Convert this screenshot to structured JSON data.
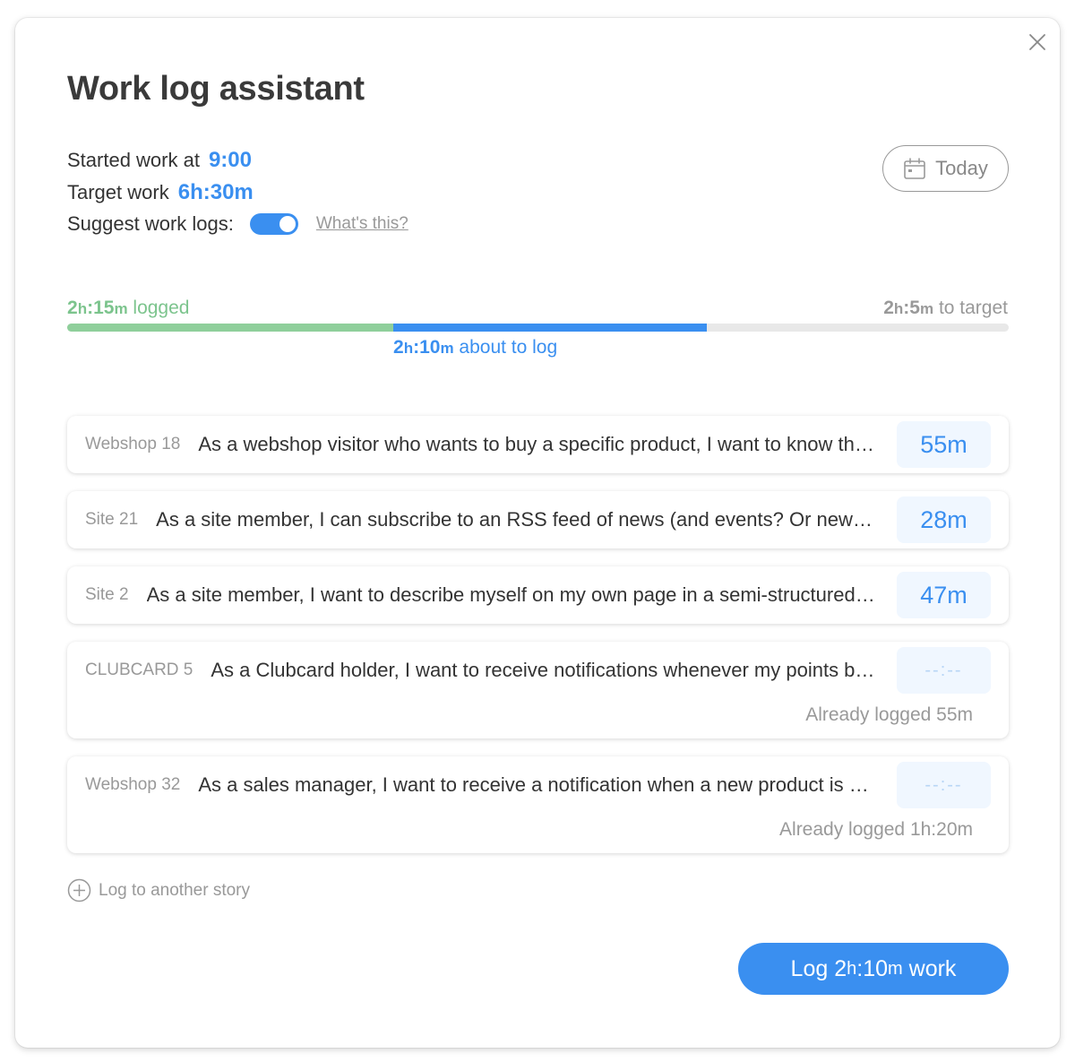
{
  "dialog": {
    "title": "Work log assistant",
    "close_icon": "close-icon"
  },
  "info": {
    "started_label": "Started work at",
    "started_value": "9:00",
    "target_label": "Target work",
    "target_value": "6h:30m",
    "suggest_label": "Suggest work logs:",
    "suggest_enabled": true,
    "whats_this": "What's this?"
  },
  "date_button": {
    "label": "Today",
    "icon": "calendar-icon"
  },
  "progress": {
    "logged_hours": "2",
    "logged_minutes": "15",
    "logged_suffix": "logged",
    "pending_hours": "2",
    "pending_minutes": "10",
    "pending_suffix": "about to log",
    "remaining_hours": "2",
    "remaining_minutes": "5",
    "remaining_suffix": "to target",
    "logged_fraction": 0.346,
    "pending_fraction": 0.333,
    "colors": {
      "logged": "#8fcf9b",
      "pending": "#3a8ff0",
      "track": "#e8e8e8"
    }
  },
  "stories": [
    {
      "key": "Webshop 18",
      "title": "As a webshop visitor who wants to buy a specific product, I want to know the product's availability before I order it.",
      "time": "55m",
      "already_logged": ""
    },
    {
      "key": "Site 21",
      "title": "As a site member, I can subscribe to an RSS feed of news (and events? Or news and events together?)",
      "time": "28m",
      "already_logged": ""
    },
    {
      "key": "Site 2",
      "title": "As a site member, I want to describe myself on my own page in a semi-structured way.",
      "time": "47m",
      "already_logged": ""
    },
    {
      "key": "CLUBCARD 5",
      "title": "As a Clubcard holder, I want to receive notifications whenever my points balance changes.",
      "time": "--:--",
      "already_logged": "Already logged 55m"
    },
    {
      "key": "Webshop 32",
      "title": "As a sales manager, I want to receive a notification when a new product is added to the webshop.",
      "time": "--:--",
      "already_logged": "Already logged 1h:20m"
    }
  ],
  "add_story": {
    "label": "Log to another story",
    "icon": "plus-circle-icon"
  },
  "submit": {
    "prefix": "Log",
    "hours": "2",
    "minutes": "10",
    "suffix": "work"
  }
}
